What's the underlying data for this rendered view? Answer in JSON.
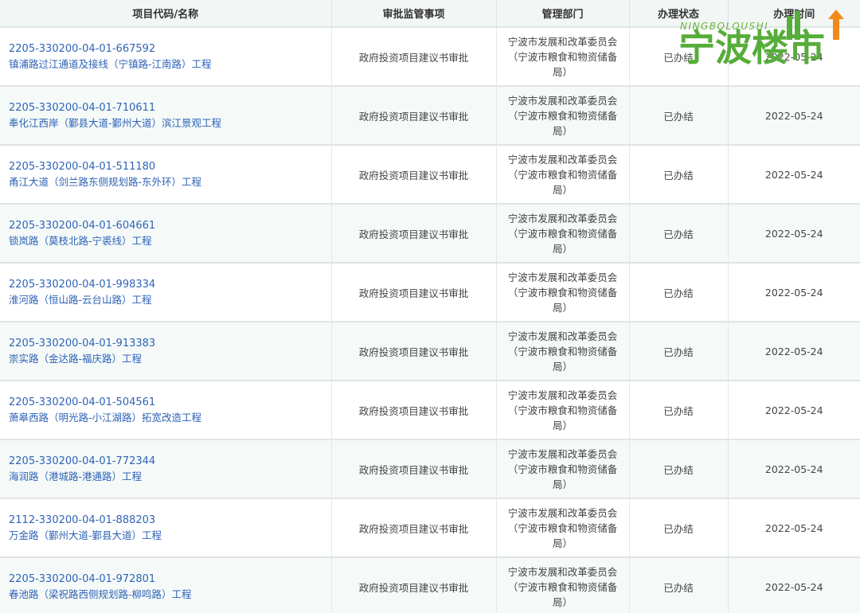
{
  "headers": [
    "项目代码/名称",
    "审批监管事项",
    "管理部门",
    "办理状态",
    "办理时间"
  ],
  "rows": [
    {
      "code": "2205-330200-04-01-667592",
      "name": "镇浦路过江通道及接线（宁镇路-江南路）工程",
      "matter": "政府投资项目建议书审批",
      "dept": "宁波市发展和改革委员会（宁波市粮食和物资储备局）",
      "status": "已办结",
      "time": "2022-05-24"
    },
    {
      "code": "2205-330200-04-01-710611",
      "name": "奉化江西岸（鄞县大道-鄞州大道）滨江景观工程",
      "matter": "政府投资项目建议书审批",
      "dept": "宁波市发展和改革委员会（宁波市粮食和物资储备局）",
      "status": "已办结",
      "time": "2022-05-24"
    },
    {
      "code": "2205-330200-04-01-511180",
      "name": "甬江大道（剑兰路东侧规划路-东外环）工程",
      "matter": "政府投资项目建议书审批",
      "dept": "宁波市发展和改革委员会（宁波市粮食和物资储备局）",
      "status": "已办结",
      "time": "2022-05-24"
    },
    {
      "code": "2205-330200-04-01-604661",
      "name": "锁岚路（莫枝北路-宁裘线）工程",
      "matter": "政府投资项目建议书审批",
      "dept": "宁波市发展和改革委员会（宁波市粮食和物资储备局）",
      "status": "已办结",
      "time": "2022-05-24"
    },
    {
      "code": "2205-330200-04-01-998334",
      "name": "淮河路（恒山路-云台山路）工程",
      "matter": "政府投资项目建议书审批",
      "dept": "宁波市发展和改革委员会（宁波市粮食和物资储备局）",
      "status": "已办结",
      "time": "2022-05-24"
    },
    {
      "code": "2205-330200-04-01-913383",
      "name": "崇实路（金达路-福庆路）工程",
      "matter": "政府投资项目建议书审批",
      "dept": "宁波市发展和改革委员会（宁波市粮食和物资储备局）",
      "status": "已办结",
      "time": "2022-05-24"
    },
    {
      "code": "2205-330200-04-01-504561",
      "name": "萧皋西路（明光路-小江湖路）拓宽改造工程",
      "matter": "政府投资项目建议书审批",
      "dept": "宁波市发展和改革委员会（宁波市粮食和物资储备局）",
      "status": "已办结",
      "time": "2022-05-24"
    },
    {
      "code": "2205-330200-04-01-772344",
      "name": "海润路（港城路-港通路）工程",
      "matter": "政府投资项目建议书审批",
      "dept": "宁波市发展和改革委员会（宁波市粮食和物资储备局）",
      "status": "已办结",
      "time": "2022-05-24"
    },
    {
      "code": "2112-330200-04-01-888203",
      "name": "万金路（鄞州大道-鄞县大道）工程",
      "matter": "政府投资项目建议书审批",
      "dept": "宁波市发展和改革委员会（宁波市粮食和物资储备局）",
      "status": "已办结",
      "time": "2022-05-24"
    },
    {
      "code": "2205-330200-04-01-972801",
      "name": "春池路（梁祝路西侧规划路-柳鸣路）工程",
      "matter": "政府投资项目建议书审批",
      "dept": "宁波市发展和改革委员会（宁波市粮食和物资储备局）",
      "status": "已办结",
      "time": "2022-05-24"
    }
  ],
  "watermark": {
    "latin": "NINGBOLOUSHI",
    "chinese": "宁波楼市"
  },
  "colors": {
    "link": "#2f63b6",
    "header_bg": "#f2f6f5",
    "alt_row_bg": "#f5faf9",
    "logo_green": "#56ad3a"
  }
}
